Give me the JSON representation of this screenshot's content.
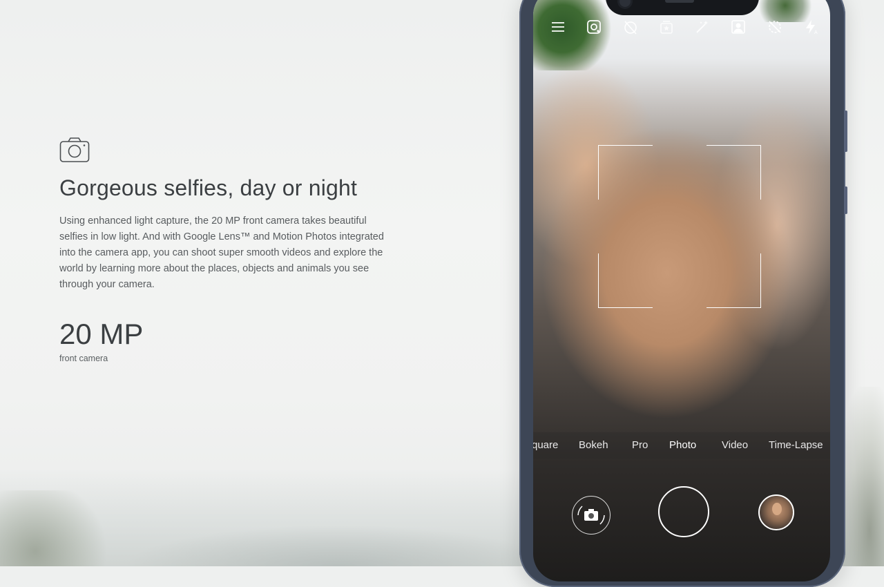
{
  "feature": {
    "icon": "camera-icon",
    "title": "Gorgeous selfies, day or night",
    "description": "Using enhanced light capture, the 20 MP front camera takes beautiful selfies in low light. And with Google Lens™ and Motion Photos integrated into the camera app, you can shoot super smooth videos and explore the world by learning more about the places, objects and animals you see through your camera.",
    "stat_value": "20 MP",
    "stat_label": "front camera"
  },
  "camera_app": {
    "toolbar_icons": [
      "menu-icon",
      "google-lens-icon",
      "timer-off-icon",
      "sticker-icon",
      "beautify-icon",
      "portrait-icon",
      "motion-photo-off-icon",
      "flash-auto-icon"
    ],
    "modes": [
      "Square",
      "Bokeh",
      "Pro",
      "Photo",
      "Video",
      "Time-Lapse"
    ],
    "modes_visible": [
      "quare",
      "Bokeh",
      "Pro",
      "Photo",
      "Video",
      "Time-Lapse"
    ],
    "active_mode": "Photo"
  },
  "colors": {
    "phone_body": "#3d4656",
    "text_dark": "#3b3f42",
    "text_body": "#585c5f"
  }
}
